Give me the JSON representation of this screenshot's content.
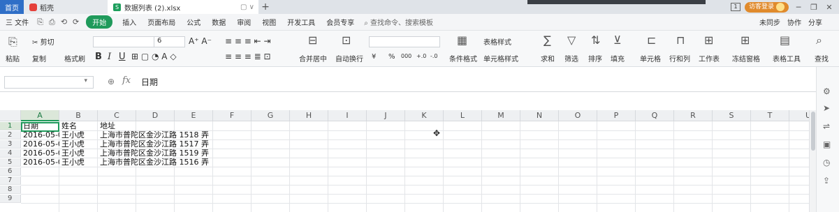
{
  "titlebar": {
    "home_label": "首页",
    "dock_label": "稻壳",
    "file_label": "数据列表 (2).xlsx",
    "file_icon": "S",
    "tab_tools": "▢ ∨",
    "new_tab": "+",
    "page_num": "1",
    "login_label": "访客登录",
    "min": "─",
    "restore": "❐",
    "close": "✕",
    "help": "?"
  },
  "menubar": {
    "file_label": "三 文件",
    "quick_access": [
      "⎘",
      "⎙",
      "⟲",
      "⟳"
    ],
    "items": [
      "开始",
      "插入",
      "页面布局",
      "公式",
      "数据",
      "审阅",
      "视图",
      "开发工具",
      "会员专享"
    ],
    "search_placeholder": "查找命令、搜索模板",
    "right_items": [
      "未同步",
      "协作",
      "分享"
    ]
  },
  "ribbon": {
    "cut": "剪切",
    "copy": "复制",
    "paste": "粘贴",
    "format_painter": "格式刷",
    "font_size": "6",
    "bold": "B",
    "italic": "I",
    "underline": "U",
    "merge_center": "合并居中",
    "wrap_text": "自动换行",
    "currency": "¥",
    "percent": "%",
    "thousands": "000",
    "inc_decimal": "+.0",
    "dec_decimal": "-.0",
    "cond_format": "条件格式",
    "table_style": "表格样式",
    "cell_style": "单元格样式",
    "sum": "求和",
    "filter": "筛选",
    "sort": "排序",
    "fill": "填充",
    "cell": "单元格",
    "row_col": "行和列",
    "worksheet": "工作表",
    "freeze": "冻结窗格",
    "table_tools": "表格工具",
    "find": "查找"
  },
  "formula": {
    "namebox_value": "",
    "fx": "fx",
    "value": "日期"
  },
  "columns": [
    "A",
    "B",
    "C",
    "D",
    "E",
    "F",
    "G",
    "H",
    "I",
    "J",
    "K",
    "L",
    "M",
    "N",
    "O",
    "P",
    "Q",
    "R",
    "S",
    "T",
    "U"
  ],
  "rows": [
    "1",
    "2",
    "3",
    "4",
    "5",
    "6",
    "7",
    "8",
    "9"
  ],
  "cells": {
    "a1": "日期",
    "b1": "姓名",
    "c1": "地址",
    "a2": "2016-05-0",
    "b2": "王小虎",
    "c2": "上海市普陀区金沙江路 1518 弄",
    "a3": "2016-05-0",
    "b3": "王小虎",
    "c3": "上海市普陀区金沙江路 1517 弄",
    "a4": "2016-05-0",
    "b4": "王小虎",
    "c4": "上海市普陀区金沙江路 1519 弄",
    "a5": "2016-05-0",
    "b5": "王小虎",
    "c5": "上海市普陀区金沙江路 1516 弄"
  },
  "colors": {
    "accent_green": "#1f9a5b",
    "home_tab_blue": "#2f6fc7",
    "login_orange": "#e08a2c"
  }
}
